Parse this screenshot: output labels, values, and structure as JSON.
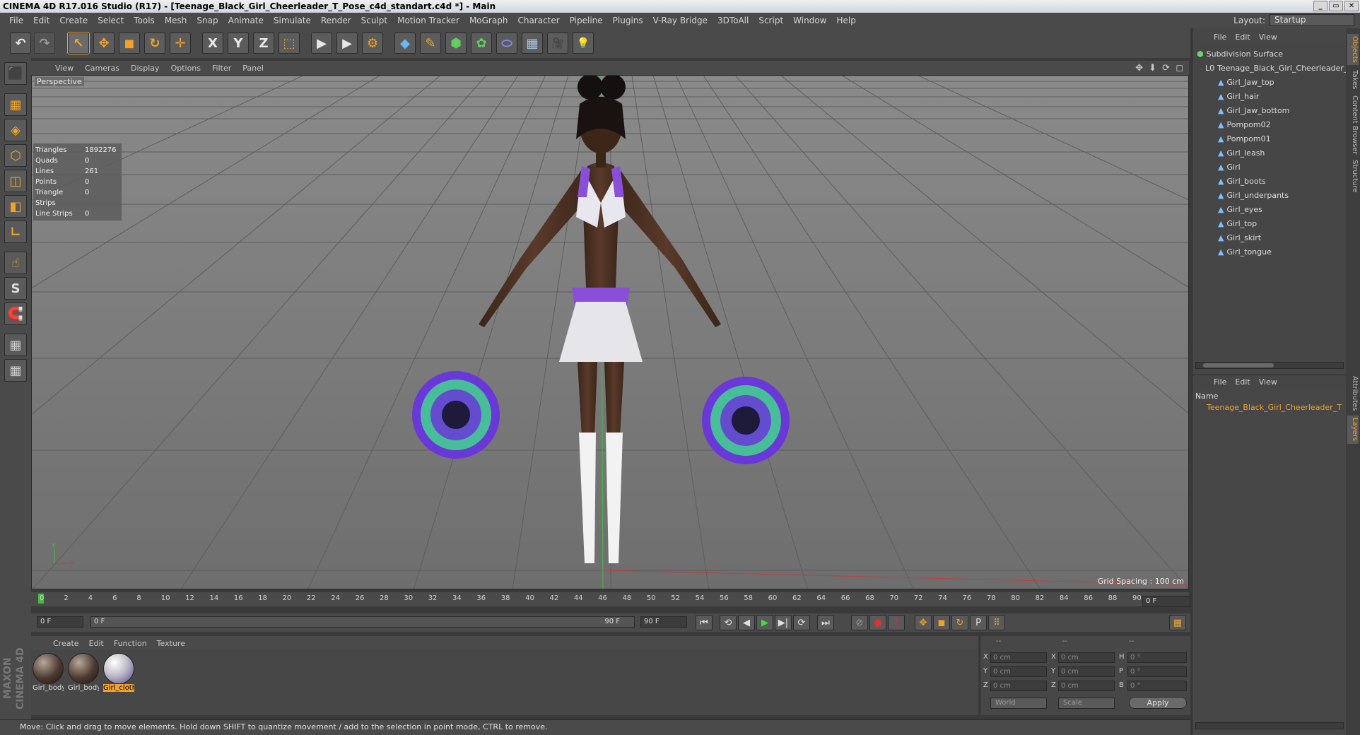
{
  "window": {
    "title": "CINEMA 4D R17.016 Studio (R17) - [Teenage_Black_Girl_Cheerleader_T_Pose_c4d_standart.c4d *] - Main",
    "buttons": [
      "_",
      "▭",
      "✕"
    ]
  },
  "menu": [
    "File",
    "Edit",
    "Create",
    "Select",
    "Tools",
    "Mesh",
    "Snap",
    "Animate",
    "Simulate",
    "Render",
    "Sculpt",
    "Motion Tracker",
    "MoGraph",
    "Character",
    "Pipeline",
    "Plugins",
    "V-Ray Bridge",
    "3DToAll",
    "Script",
    "Window",
    "Help"
  ],
  "layout": {
    "label": "Layout:",
    "value": "Startup"
  },
  "toolbar": {
    "undo": "↶",
    "redo": "↷",
    "select": "↖",
    "move": "✥",
    "scale": "◼",
    "rotate": "↻",
    "live": "✛",
    "x": "X",
    "y": "Y",
    "z": "Z",
    "coord": "⬚",
    "render_view": "▶",
    "render_pv": "▶",
    "render_settings": "⚙",
    "cube": "◆",
    "pen": "✎",
    "nurbs": "⬢",
    "mograph": "✿",
    "deform": "⬭",
    "scene": "▦",
    "camera": "🎥",
    "light": "💡"
  },
  "left_tools": [
    "⬛",
    "▦",
    "◈",
    "⬡",
    "◫",
    "◧",
    "∟",
    "☝",
    "S",
    "🧲",
    "▦",
    "▦"
  ],
  "brand": "MAXON CINEMA 4D",
  "viewport": {
    "menu": [
      "View",
      "Cameras",
      "Display",
      "Options",
      "Filter",
      "Panel"
    ],
    "nav_icons": "✥ ⬇ ⟳ ◻",
    "label": "Perspective",
    "stats": [
      {
        "k": "Triangles",
        "v": "1892276"
      },
      {
        "k": "Quads",
        "v": "0"
      },
      {
        "k": "Lines",
        "v": "261"
      },
      {
        "k": "Points",
        "v": "0"
      },
      {
        "k": "Triangle Strips",
        "v": "0"
      },
      {
        "k": "Line Strips",
        "v": "0"
      }
    ],
    "grid_spacing": "Grid Spacing : 100 cm",
    "axis": {
      "y": "Y",
      "x": "X"
    }
  },
  "timeline": {
    "ticks": [
      "0",
      "2",
      "4",
      "6",
      "8",
      "10",
      "12",
      "14",
      "16",
      "18",
      "20",
      "22",
      "24",
      "26",
      "28",
      "30",
      "32",
      "34",
      "36",
      "38",
      "40",
      "42",
      "44",
      "46",
      "48",
      "50",
      "52",
      "54",
      "56",
      "58",
      "60",
      "62",
      "64",
      "66",
      "68",
      "70",
      "72",
      "74",
      "76",
      "78",
      "80",
      "82",
      "84",
      "86",
      "88",
      "90"
    ],
    "current": "0 F"
  },
  "transport": {
    "start": "0 F",
    "min": "0 F",
    "max_inner": "90 F",
    "end": "90 F",
    "buttons": [
      "⏮",
      "⟲",
      "◀",
      "▶",
      "▶|",
      "⟳",
      "⏭"
    ],
    "key_buttons": [
      "⊘",
      "●",
      "?",
      "✥",
      "◼",
      "↻",
      "P",
      "⠿",
      "▦"
    ]
  },
  "materials": {
    "menu": [
      "Create",
      "Edit",
      "Function",
      "Texture"
    ],
    "items": [
      {
        "label": "Girl_body",
        "kind": "skin",
        "selected": false
      },
      {
        "label": "Girl_body",
        "kind": "skin",
        "selected": false
      },
      {
        "label": "Girl_cloth",
        "kind": "cloth",
        "selected": true
      }
    ]
  },
  "coords": {
    "headers": [
      "--",
      "--",
      "--"
    ],
    "rows": [
      {
        "a": "X",
        "av": "0 cm",
        "b": "X",
        "bv": "0 cm",
        "c": "H",
        "cv": "0 °"
      },
      {
        "a": "Y",
        "av": "0 cm",
        "b": "Y",
        "bv": "0 cm",
        "c": "P",
        "cv": "0 °"
      },
      {
        "a": "Z",
        "av": "0 cm",
        "b": "Z",
        "bv": "0 cm",
        "c": "B",
        "cv": "0 °"
      }
    ],
    "mode1": "World",
    "mode2": "Scale",
    "apply": "Apply"
  },
  "status": "Move: Click and drag to move elements. Hold down SHIFT to quantize movement / add to the selection in point mode, CTRL to remove.",
  "objects": {
    "menu": [
      "File",
      "Edit",
      "View"
    ],
    "root": "Subdivision Surface",
    "group": "Teenage_Black_Girl_Cheerleader_T",
    "children": [
      "Girl_Jaw_top",
      "Girl_hair",
      "Girl_Jaw_bottom",
      "Pompom02",
      "Pompom01",
      "Girl_leash",
      "Girl",
      "Girl_boots",
      "Girl_underpants",
      "Girl_eyes",
      "Girl_top",
      "Girl_skirt",
      "Girl_tongue"
    ]
  },
  "layers": {
    "menu": [
      "File",
      "Edit",
      "View"
    ],
    "name_header": "Name",
    "item": "Teenage_Black_Girl_Cheerleader_T"
  },
  "vtabs": [
    "Objects",
    "Takes",
    "Content Browser",
    "Structure",
    "Attributes",
    "Layers"
  ],
  "colors": {
    "accent": "#f2a227",
    "bg": "#3a3a3a",
    "panel": "#4a4a4a",
    "viewport": "#7a7a7a"
  }
}
